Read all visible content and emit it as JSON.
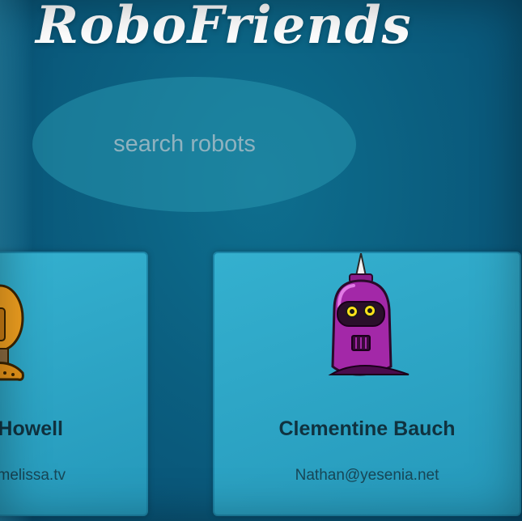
{
  "app": {
    "title": "RoboFriends"
  },
  "search": {
    "placeholder": "search robots",
    "value": ""
  },
  "cards": [
    {
      "name": "Howell",
      "email": "melissa.tv",
      "robot_icon": "orange-robot-icon"
    },
    {
      "name": "Clementine Bauch",
      "email": "Nathan@yesenia.net",
      "robot_icon": "purple-robot-icon"
    }
  ],
  "colors": {
    "background": "#0b5f80",
    "card": "#2ba3c4",
    "title": "#ffffff",
    "card_text": "#10323f"
  }
}
